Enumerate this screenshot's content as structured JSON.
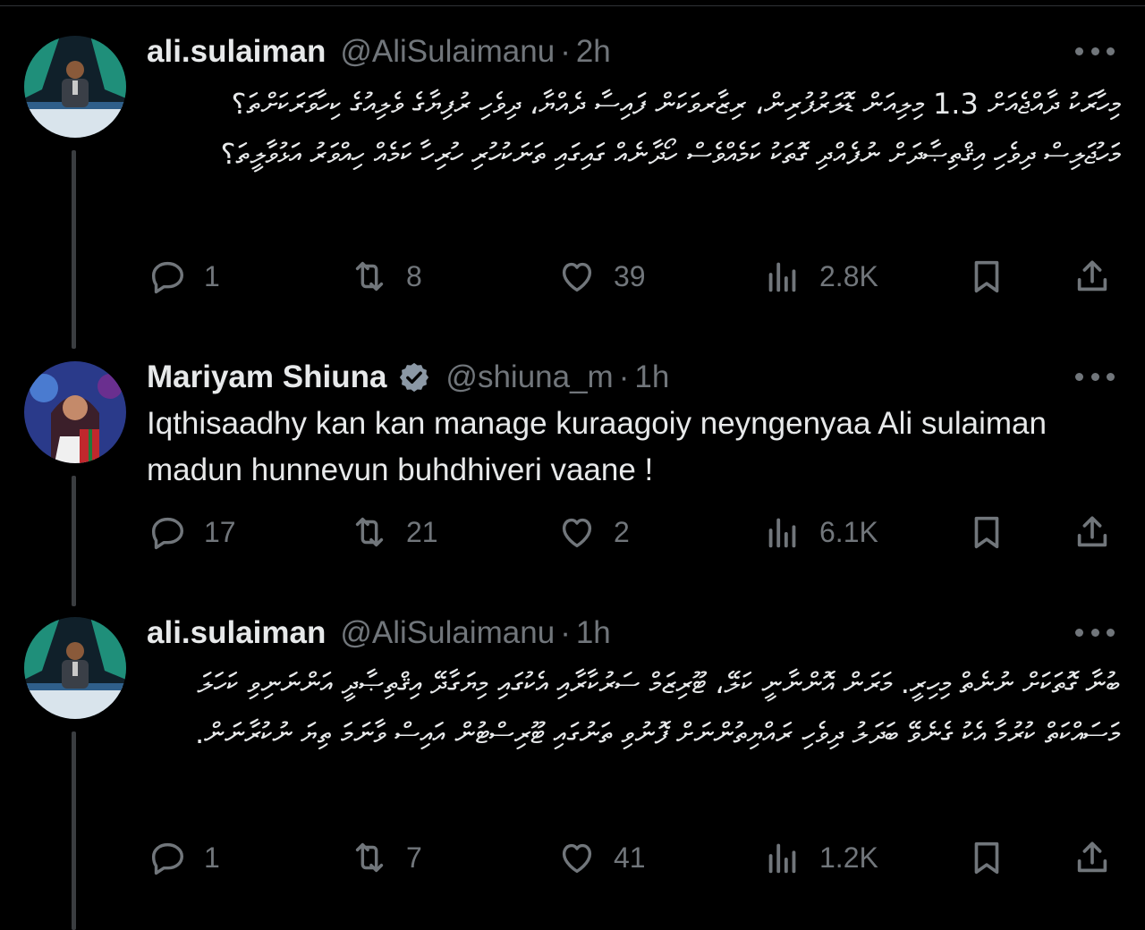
{
  "tweets": [
    {
      "name": "ali.sulaiman",
      "handle": "@AliSulaimanu",
      "time": "2h",
      "verified": false,
      "text": "މިހާރަކު ދާއްޖެއަށް 1.3 މިލިއަން ޑޮލަރުފުރިން، ރިޒާރވަކަން ފައިސާ ދެއްޔާ، ދިވެހި ރުފިޔާގެ ވެލިއުގެ ކިހާވަރަކަށްތަ؟ މަހުޖަލިސް ދިވެހި އިޤްތިޞާދަށް ނުފެއްދި ގޮތަކު ކަމެއްވެސް ހޯދާނެއް ގައިގައި ތަނަކުހުރި ހުރިހާ ކަމެއް ހިއްވަރު އަޅުވާލީތަ؟",
      "replies": "1",
      "reposts": "8",
      "likes": "39",
      "views": "2.8K"
    },
    {
      "name": "Mariyam Shiuna",
      "handle": "@shiuna_m",
      "time": "1h",
      "verified": true,
      "text": "Iqthisaadhy kan kan manage kuraagoiy neyngenyaa Ali sulaiman madun hunnevun buhdhiveri vaane !",
      "replies": "17",
      "reposts": "21",
      "likes": "2",
      "views": "6.1K"
    },
    {
      "name": "ali.sulaiman",
      "handle": "@AliSulaimanu",
      "time": "1h",
      "verified": false,
      "text": "ބުނާ ގޮތަކަށް ނުނެތް މިހިރީ. މަރަން އޮންނާނީ ކަލޭ، ޓޫރިޒަމް ސަރުކާރާއި އެކުގައި މިޔަގާދޭ އިޤްތިޞާދީ އަންނަނިވި ކަހަލަ މަސައްކަތް ކުރުމާ އެކު ގެނެވޭ ބަދަލު ދިވެހި ރައްޔިތުންނަށް ފޮނުވި ތަނުގައި ޓޫރިސްޓުން އައިސް ވާނަމަ ތިޔަ ނުކުރާނަން.",
      "replies": "1",
      "reposts": "7",
      "likes": "41",
      "views": "1.2K"
    }
  ],
  "colors": {
    "background": "#000000",
    "text": "#e7e9ea",
    "muted": "#71767b",
    "verified": "#8b98a5"
  },
  "icons": [
    "reply-icon",
    "repost-icon",
    "like-icon",
    "views-icon",
    "bookmark-icon",
    "share-icon",
    "more-icon",
    "verified-icon"
  ]
}
